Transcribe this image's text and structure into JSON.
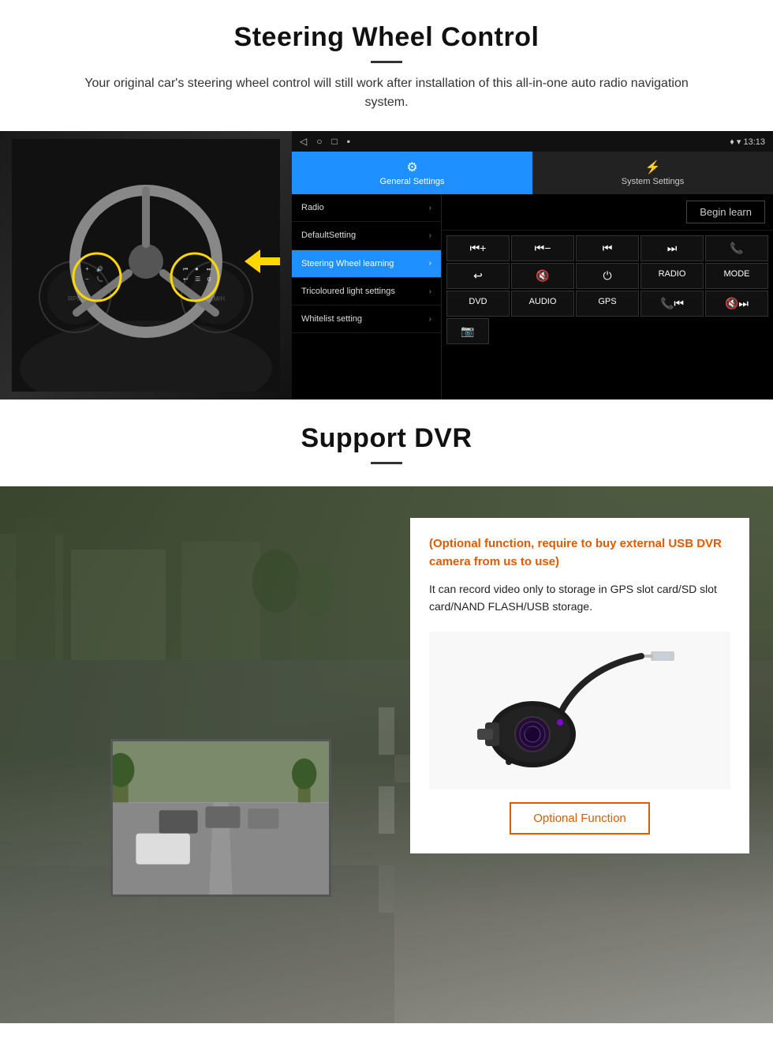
{
  "page": {
    "section1": {
      "title": "Steering Wheel Control",
      "subtitle": "Your original car's steering wheel control will still work after installation of this all-in-one auto radio navigation system.",
      "android_bar": {
        "time": "13:13",
        "icons_left": [
          "◁",
          "○",
          "□",
          "▪"
        ]
      },
      "tabs": {
        "general": {
          "label": "General Settings",
          "icon": "⚙"
        },
        "system": {
          "label": "System Settings",
          "icon": "🔗"
        }
      },
      "menu_items": [
        {
          "label": "Radio",
          "active": false
        },
        {
          "label": "DefaultSetting",
          "active": false
        },
        {
          "label": "Steering Wheel learning",
          "active": true
        },
        {
          "label": "Tricoloured light settings",
          "active": false
        },
        {
          "label": "Whitelist setting",
          "active": false
        }
      ],
      "begin_learn": "Begin learn",
      "control_buttons_row1": [
        "⏮+",
        "⏮−",
        "⏮",
        "⏭",
        "📞"
      ],
      "control_buttons_row2": [
        "↩",
        "🔇",
        "⏻",
        "RADIO",
        "MODE"
      ],
      "control_buttons_row3": [
        "DVD",
        "AUDIO",
        "GPS",
        "📞⏮",
        "🔇⏭"
      ],
      "control_buttons_row4_icon": "📷"
    },
    "section2": {
      "title": "Support DVR",
      "optional_text": "(Optional function, require to buy external USB DVR camera from us to use)",
      "body_text": "It can record video only to storage in GPS slot card/SD slot card/NAND FLASH/USB storage.",
      "optional_function_btn": "Optional Function"
    }
  }
}
